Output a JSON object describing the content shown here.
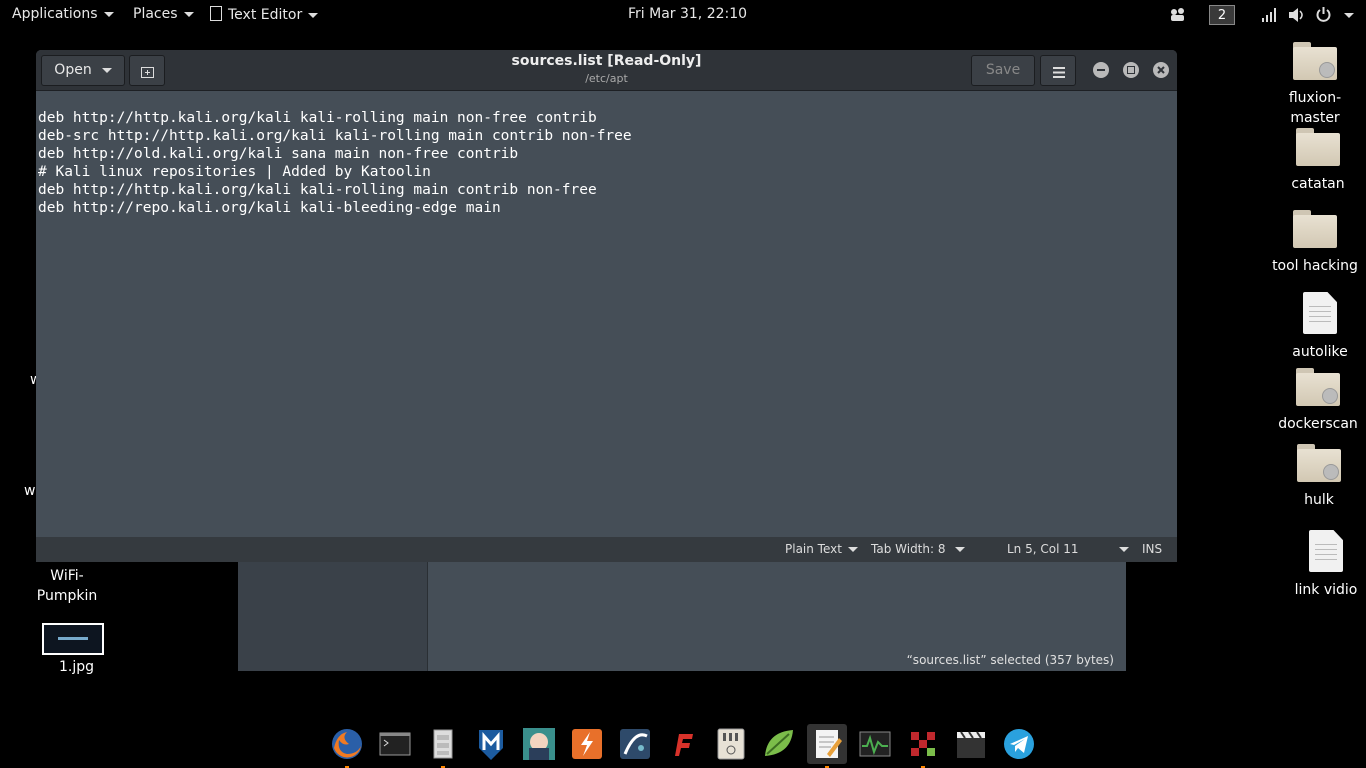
{
  "topbar": {
    "applications": "Applications",
    "places": "Places",
    "app_menu": "Text Editor",
    "clock": "Fri Mar 31, 22:10",
    "workspace": "2"
  },
  "desktop_icons": [
    {
      "label": "fluxion-\nmaster",
      "type": "folder-locked"
    },
    {
      "label": "catatan",
      "type": "folder"
    },
    {
      "label": "tool hacking",
      "type": "folder"
    },
    {
      "label": "autolike",
      "type": "file"
    },
    {
      "label": "dockerscan",
      "type": "folder-locked"
    },
    {
      "label": "hulk",
      "type": "folder-locked"
    },
    {
      "label": "link vidio",
      "type": "file"
    }
  ],
  "left_icons": {
    "wifi_pumpkin": "WiFi-\nPumpkin",
    "jpg": "1.jpg",
    "partial1": "w",
    "partial2": "w"
  },
  "window": {
    "open_label": "Open",
    "save_label": "Save",
    "title": "sources.list [Read-Only]",
    "subtitle": "/etc/apt",
    "lines": [
      "deb http://http.kali.org/kali kali-rolling main non-free contrib",
      "deb-src http://http.kali.org/kali kali-rolling main contrib non-free",
      "deb http://old.kali.org/kali sana main non-free contrib",
      "# Kali linux repositories | Added by Katoolin",
      "deb http://http.kali.org/kali kali-rolling main contrib non-free",
      "deb http://repo.kali.org/kali kali-bleeding-edge main"
    ],
    "status": {
      "syntax": "Plain Text",
      "tab_width": "Tab Width: 8",
      "position": "Ln 5, Col 11",
      "mode": "INS"
    }
  },
  "file_manager": {
    "status": "“sources.list” selected  (357 bytes)"
  },
  "dock_apps": [
    "firefox-icon",
    "terminal-icon",
    "files-icon",
    "metasploit-icon",
    "anime-app-icon",
    "burpsuite-icon",
    "maltego-icon",
    "flash-icon",
    "mixer-icon",
    "leafpad-icon",
    "text-editor-icon",
    "system-monitor-icon",
    "armitage-icon",
    "video-editor-icon",
    "telegram-icon"
  ]
}
